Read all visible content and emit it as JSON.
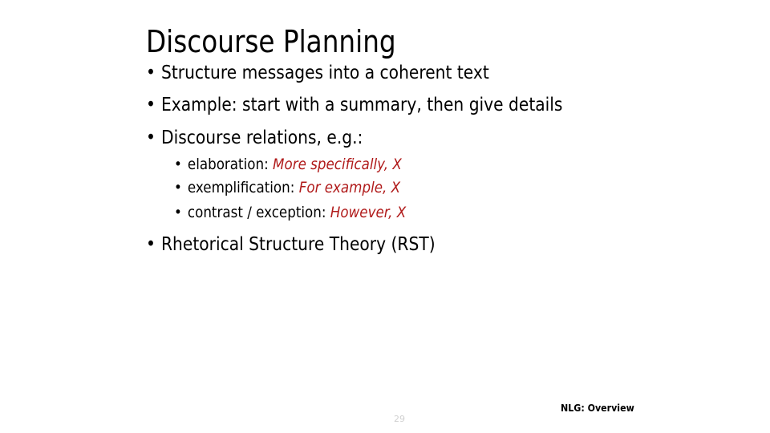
{
  "slide": {
    "title": "Discourse Planning",
    "bullets": [
      {
        "text": "Structure messages into a coherent text"
      },
      {
        "text": "Example: start with a summary, then give details"
      },
      {
        "text": "Discourse relations, e.g.:"
      }
    ],
    "sub_bullets": [
      {
        "label": "elaboration: ",
        "example": "More specifically, X"
      },
      {
        "label": "exemplification: ",
        "example": "For example, X"
      },
      {
        "label": "contrast / exception: ",
        "example": "However, X"
      }
    ],
    "last_bullet": "Rhetorical Structure Theory (RST)",
    "bullet_glyph": "•",
    "page_number": "29",
    "footer": "NLG: Overview",
    "accent_color": "#b01a1a"
  }
}
